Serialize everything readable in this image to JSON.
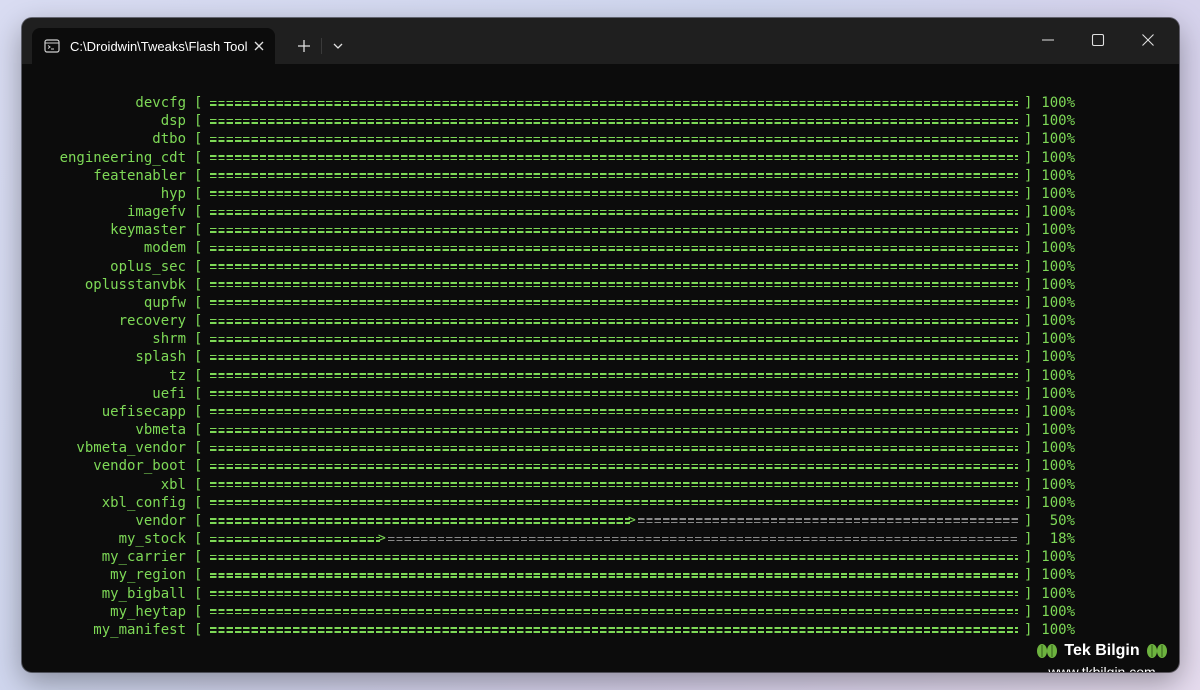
{
  "window": {
    "tab_title": "C:\\Droidwin\\Tweaks\\Flash Tool",
    "tab_icon": "terminal-icon",
    "close_icon": "close-icon",
    "new_tab_icon": "plus-icon",
    "dropdown_icon": "chevron-down-icon",
    "minimize_icon": "minimize-icon",
    "maximize_icon": "maximize-icon",
    "window_close_icon": "close-icon"
  },
  "colors": {
    "terminal_bg": "#0c0c0c",
    "titlebar_bg": "#1f1f1f",
    "text_green": "#7ed957",
    "bar_remaining": "#8a8a8a"
  },
  "partitions": [
    {
      "name": "devcfg",
      "percent_label": "100%",
      "progress": 1.0
    },
    {
      "name": "dsp",
      "percent_label": "100%",
      "progress": 1.0
    },
    {
      "name": "dtbo",
      "percent_label": "100%",
      "progress": 1.0
    },
    {
      "name": "engineering_cdt",
      "percent_label": "100%",
      "progress": 1.0
    },
    {
      "name": "featenabler",
      "percent_label": "100%",
      "progress": 1.0
    },
    {
      "name": "hyp",
      "percent_label": "100%",
      "progress": 1.0
    },
    {
      "name": "imagefv",
      "percent_label": "100%",
      "progress": 1.0
    },
    {
      "name": "keymaster",
      "percent_label": "100%",
      "progress": 1.0
    },
    {
      "name": "modem",
      "percent_label": "100%",
      "progress": 1.0
    },
    {
      "name": "oplus_sec",
      "percent_label": "100%",
      "progress": 1.0
    },
    {
      "name": "oplusstanvbk",
      "percent_label": "100%",
      "progress": 1.0
    },
    {
      "name": "qupfw",
      "percent_label": "100%",
      "progress": 1.0
    },
    {
      "name": "recovery",
      "percent_label": "100%",
      "progress": 1.0
    },
    {
      "name": "shrm",
      "percent_label": "100%",
      "progress": 1.0
    },
    {
      "name": "splash",
      "percent_label": "100%",
      "progress": 1.0
    },
    {
      "name": "tz",
      "percent_label": "100%",
      "progress": 1.0
    },
    {
      "name": "uefi",
      "percent_label": "100%",
      "progress": 1.0
    },
    {
      "name": "uefisecapp",
      "percent_label": "100%",
      "progress": 1.0
    },
    {
      "name": "vbmeta",
      "percent_label": "100%",
      "progress": 1.0
    },
    {
      "name": "vbmeta_vendor",
      "percent_label": "100%",
      "progress": 1.0
    },
    {
      "name": "vendor_boot",
      "percent_label": "100%",
      "progress": 1.0
    },
    {
      "name": "xbl",
      "percent_label": "100%",
      "progress": 1.0
    },
    {
      "name": "xbl_config",
      "percent_label": "100%",
      "progress": 1.0
    },
    {
      "name": "vendor",
      "percent_label": "50%",
      "progress": 0.52
    },
    {
      "name": "my_stock",
      "percent_label": "18%",
      "progress": 0.21
    },
    {
      "name": "my_carrier",
      "percent_label": "100%",
      "progress": 1.0
    },
    {
      "name": "my_region",
      "percent_label": "100%",
      "progress": 1.0
    },
    {
      "name": "my_bigball",
      "percent_label": "100%",
      "progress": 1.0
    },
    {
      "name": "my_heytap",
      "percent_label": "100%",
      "progress": 1.0
    },
    {
      "name": "my_manifest",
      "percent_label": "100%",
      "progress": 1.0
    }
  ],
  "bracket_left": "[",
  "bracket_right": "]",
  "arrow": ">",
  "watermark": {
    "title": "Tek Bilgin",
    "url": "www.tkbilgin.com",
    "logo_icon": "tek-bilgin-logo",
    "logo_color": "#6db33f"
  }
}
